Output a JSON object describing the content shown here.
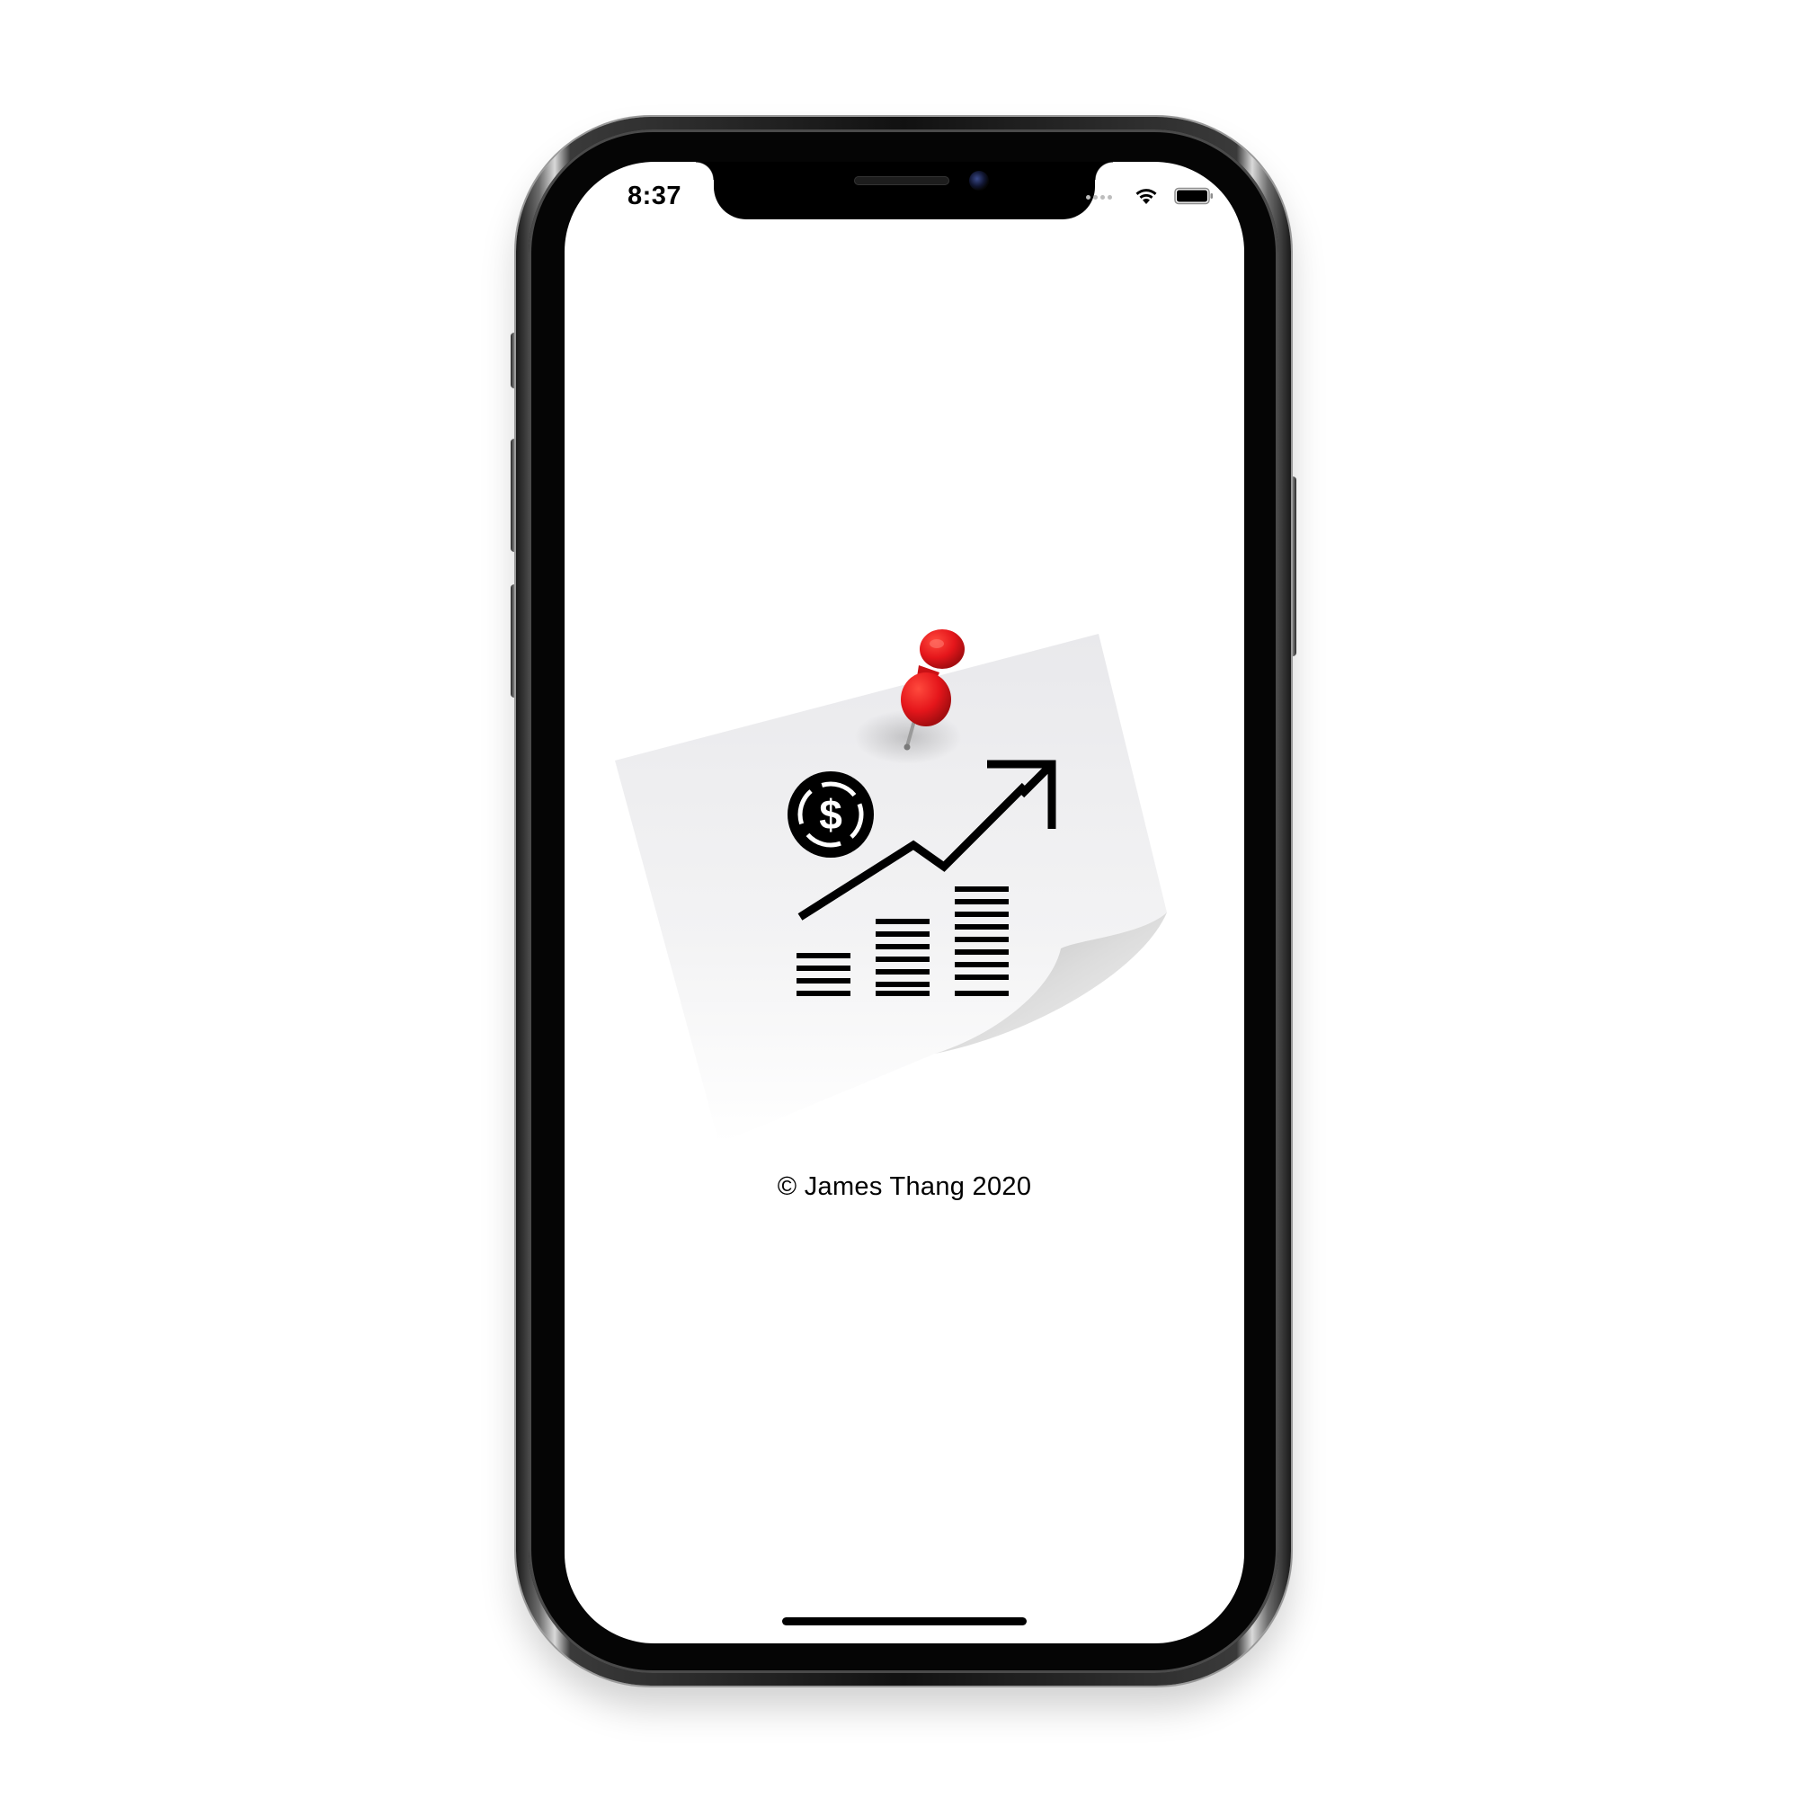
{
  "status_bar": {
    "time": "8:37",
    "wifi_icon": "wifi-icon",
    "battery_icon": "battery-icon"
  },
  "splash": {
    "logo_icon": "sticky-note-finance-chart-icon",
    "pin_icon": "red-pushpin-icon",
    "copyright": "© James Thang 2020"
  },
  "colors": {
    "pin_red": "#e5161b",
    "note_gray": "#eeeeef",
    "icon_black": "#000000"
  }
}
